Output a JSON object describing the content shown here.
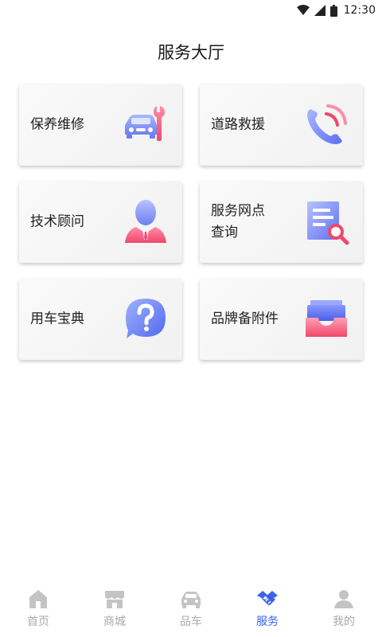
{
  "status_bar": {
    "time": "12:30"
  },
  "page": {
    "title": "服务大厅"
  },
  "services": [
    {
      "label": "保养维修",
      "icon": "car-wrench-icon"
    },
    {
      "label": "道路救援",
      "icon": "phone-call-icon"
    },
    {
      "label": "技术顾问",
      "icon": "person-consultant-icon"
    },
    {
      "label": "服务网点查询",
      "label_lines": [
        "服务网点",
        "查询"
      ],
      "icon": "document-search-icon"
    },
    {
      "label": "用车宝典",
      "icon": "question-bubble-icon"
    },
    {
      "label": "品牌备附件",
      "icon": "parts-tray-icon"
    }
  ],
  "tabbar": {
    "tabs": [
      {
        "label": "首页",
        "icon": "home-icon"
      },
      {
        "label": "商城",
        "icon": "store-icon"
      },
      {
        "label": "品车",
        "icon": "car-icon"
      },
      {
        "label": "服务",
        "icon": "handshake-icon",
        "active": true
      },
      {
        "label": "我的",
        "icon": "user-icon"
      }
    ]
  },
  "colors": {
    "accent": "#3b62e8",
    "inactive": "#aaaaaa",
    "icon_pink": "#f0476b",
    "icon_blue": "#6b7ff0"
  }
}
